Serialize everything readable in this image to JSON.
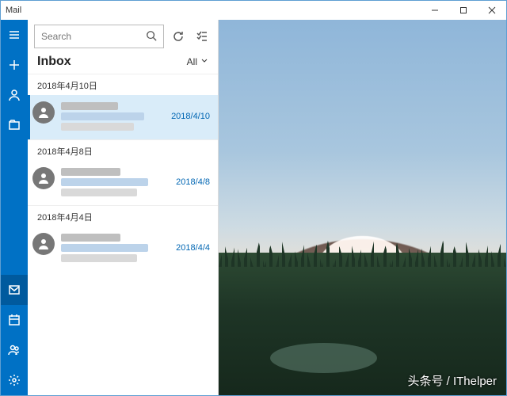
{
  "window": {
    "title": "Mail"
  },
  "rail": {
    "items": [
      {
        "name": "menu-icon"
      },
      {
        "name": "new-mail-icon"
      },
      {
        "name": "account-icon"
      },
      {
        "name": "folder-icon"
      }
    ],
    "bottom": [
      {
        "name": "mail-icon",
        "selected": true
      },
      {
        "name": "calendar-icon"
      },
      {
        "name": "people-icon"
      },
      {
        "name": "settings-icon"
      }
    ]
  },
  "search": {
    "placeholder": "Search"
  },
  "folder": {
    "title": "Inbox",
    "filter": "All"
  },
  "groups": [
    {
      "date_label": "2018年4月10日",
      "messages": [
        {
          "date": "2018/4/10",
          "selected": true
        }
      ]
    },
    {
      "date_label": "2018年4月8日",
      "messages": [
        {
          "date": "2018/4/8",
          "selected": false
        }
      ]
    },
    {
      "date_label": "2018年4月4日",
      "messages": [
        {
          "date": "2018/4/4",
          "selected": false
        }
      ]
    }
  ],
  "watermark": "头条号 / IThelper"
}
